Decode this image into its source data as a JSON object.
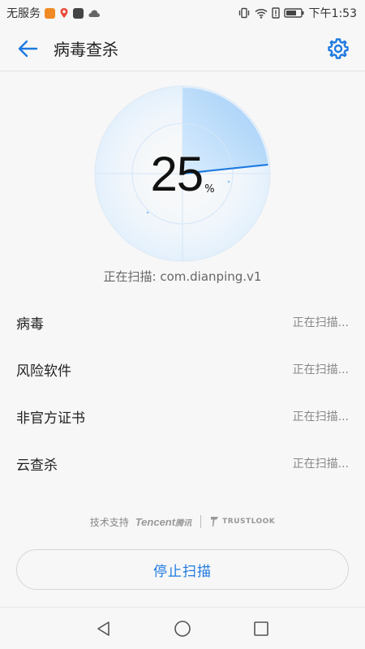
{
  "status_bar": {
    "carrier": "无服务",
    "time": "下午1:53",
    "icons": [
      "video-app-icon",
      "maps-app-icon",
      "app-icon",
      "cloud-icon",
      "vibrate-icon",
      "wifi-icon",
      "alert-icon",
      "battery-icon"
    ]
  },
  "app_bar": {
    "title": "病毒查杀",
    "back_icon": "arrow-left-icon",
    "settings_icon": "gear-icon"
  },
  "scan": {
    "progress_value": "25",
    "progress_unit": "%",
    "progress_fraction": 0.25,
    "current_label": "正在扫描: com.dianping.v1"
  },
  "items": [
    {
      "label": "病毒",
      "status": "正在扫描..."
    },
    {
      "label": "风险软件",
      "status": "正在扫描..."
    },
    {
      "label": "非官方证书",
      "status": "正在扫描..."
    },
    {
      "label": "云查杀",
      "status": "正在扫描..."
    }
  ],
  "support": {
    "prefix": "技术支持",
    "tencent_en": "Tencent",
    "tencent_cn": "腾讯",
    "trustlook": "TRUSTLOOK"
  },
  "stop_button": {
    "label": "停止扫描"
  },
  "nav": {
    "back": "back-triangle-icon",
    "home": "home-circle-icon",
    "recent": "recent-square-icon"
  },
  "colors": {
    "accent": "#1e7ae0",
    "radar_fill": "#a9d4fb",
    "radar_line": "#d6e9fa"
  }
}
